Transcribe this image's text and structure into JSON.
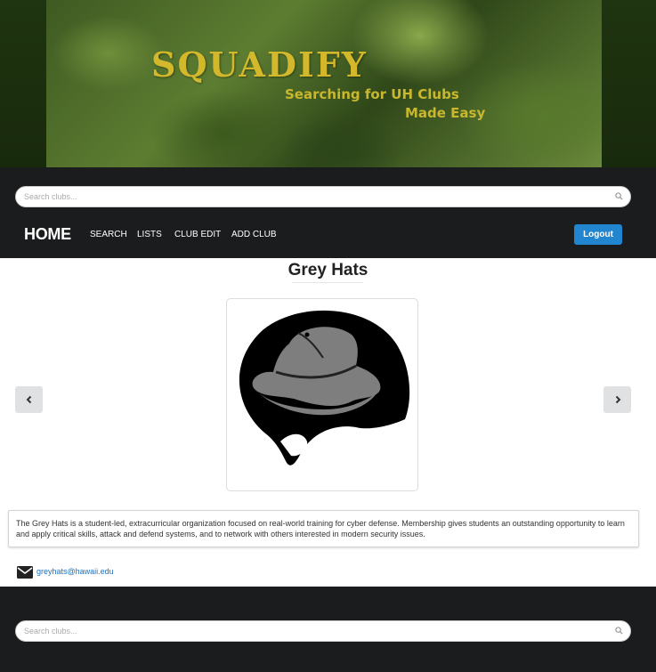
{
  "banner": {
    "title": "SQUADIFY",
    "tagline_line1": "Searching for UH Clubs",
    "tagline_line2": "Made Easy"
  },
  "search_top": {
    "placeholder": "Search clubs...",
    "icon": "search-icon"
  },
  "nav": {
    "home": "HOME",
    "items": [
      "SEARCH",
      "LISTS",
      "CLUB EDIT",
      "ADD CLUB"
    ],
    "logout": "Logout"
  },
  "club": {
    "name": "Grey Hats",
    "logo": "grey-hat-logo",
    "description": "The Grey Hats is a student-led, extracurricular organization focused on real-world training for cyber defense. Membership gives students an outstanding opportunity to learn and apply critical skills, attack and defend systems, and to network with others interested in modern security issues.",
    "email": "greyhats@hawaii.edu"
  },
  "carousel": {
    "prev_icon": "chevron-left-icon",
    "next_icon": "chevron-right-icon"
  },
  "search_bottom": {
    "placeholder": "Search clubs...",
    "icon": "search-icon"
  },
  "colors": {
    "nav_bg": "#1b1c1d",
    "logout": "#2185d0",
    "brand_gold": "#d2b82a",
    "link": "#1e70bf"
  }
}
